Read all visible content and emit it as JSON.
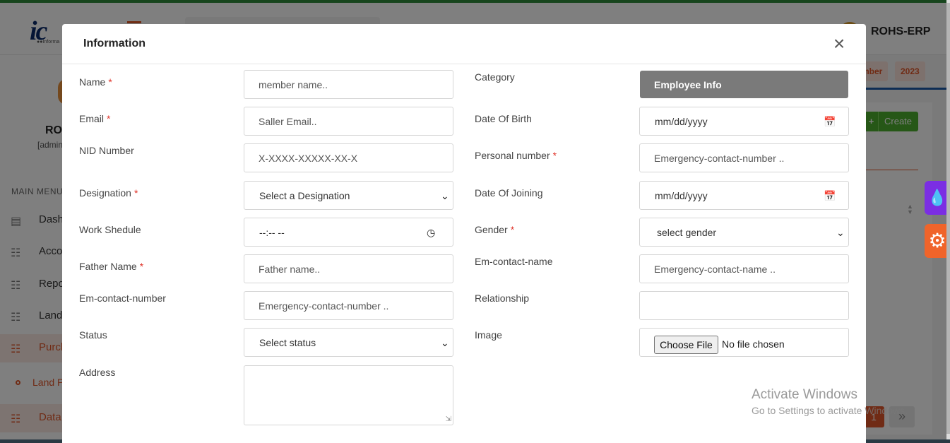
{
  "background": {
    "logo_text": "ic",
    "logo_sub": "●●Informa",
    "app_name": "ROHS-ERP",
    "profile_name": "RO",
    "profile_role": "[admin",
    "menu_header": "MAIN MENU",
    "menu_items": [
      {
        "label": "Dash",
        "icon": "dashboard-icon"
      },
      {
        "label": "Acco",
        "icon": "sitemap-icon"
      },
      {
        "label": "Repo",
        "icon": "sitemap-icon"
      },
      {
        "label": "Land",
        "icon": "sitemap-icon"
      },
      {
        "label": "Purch",
        "icon": "sitemap-icon",
        "active": true
      },
      {
        "label": "Land P",
        "icon": "circle-icon",
        "sub": true
      },
      {
        "label": "Data",
        "icon": "sitemap-icon"
      }
    ],
    "year_tags": [
      "mber",
      "2023"
    ],
    "create_label": "Create",
    "create_icon": "+",
    "page_current": "1",
    "page_next_icon": "»",
    "accent_color": "#e0572a",
    "brand_green": "#2e8b3a"
  },
  "modal": {
    "title": "Information",
    "close_icon": "×",
    "left": {
      "name": {
        "label": "Name",
        "required": "*",
        "placeholder": "member name.."
      },
      "email": {
        "label": "Email",
        "required": "*",
        "placeholder": "Saller Email.."
      },
      "nid": {
        "label": "NID Number",
        "placeholder": "X-XXXX-XXXXX-XX-X"
      },
      "designation": {
        "label": "Designation",
        "required": "*",
        "selected": "Select a Designation"
      },
      "work_schedule": {
        "label": "Work Shedule",
        "value": "--:-- --"
      },
      "father_name": {
        "label": "Father Name",
        "required": "*",
        "placeholder": "Father name.."
      },
      "em_contact_number": {
        "label": "Em-contact-number",
        "placeholder": "Emergency-contact-number .."
      },
      "status": {
        "label": "Status",
        "selected": "Select status"
      },
      "address": {
        "label": "Address"
      }
    },
    "right": {
      "category": {
        "label": "Category",
        "value": "Employee Info"
      },
      "dob": {
        "label": "Date Of Birth",
        "value": "mm/dd/yyyy"
      },
      "personal_number": {
        "label": "Personal number",
        "required": "*",
        "placeholder": "Emergency-contact-number .."
      },
      "doj": {
        "label": "Date Of Joining",
        "value": "mm/dd/yyyy"
      },
      "gender": {
        "label": "Gender",
        "required": "*",
        "selected": "select gender"
      },
      "em_contact_name": {
        "label": "Em-contact-name",
        "placeholder": "Emergency-contact-name .."
      },
      "relationship": {
        "label": "Relationship",
        "placeholder": ""
      },
      "image": {
        "label": "Image",
        "button": "Choose File",
        "status": "No file chosen"
      }
    }
  },
  "watermark": {
    "line1": "Activate Windows",
    "line2": "Go to Settings to activate Windows."
  }
}
